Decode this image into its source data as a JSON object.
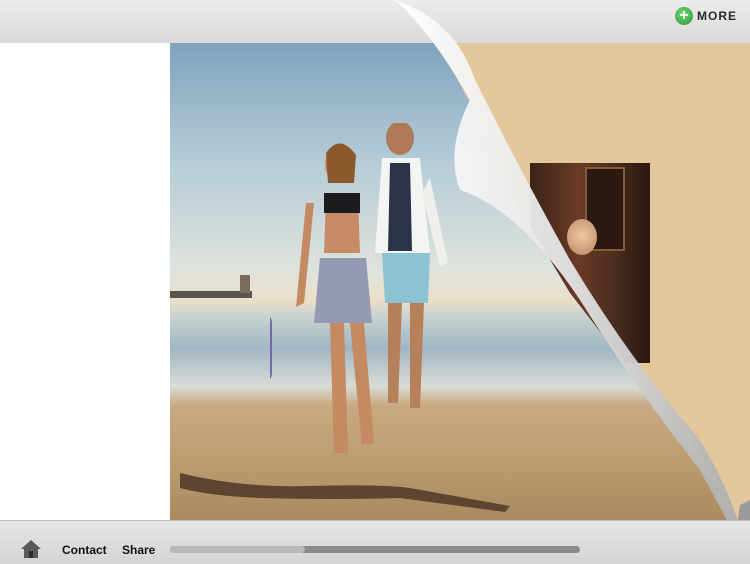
{
  "topbar": {
    "more_label": "MORE",
    "more_icon": "plus-circle-icon",
    "more_icon_color": "#34a83c"
  },
  "bottombar": {
    "home_icon": "home-icon",
    "contact_label": "Contact",
    "share_label": "Share",
    "progress": 0.33
  },
  "colors": {
    "next_page": "#e3c89b",
    "bar_background": "#dedede"
  }
}
